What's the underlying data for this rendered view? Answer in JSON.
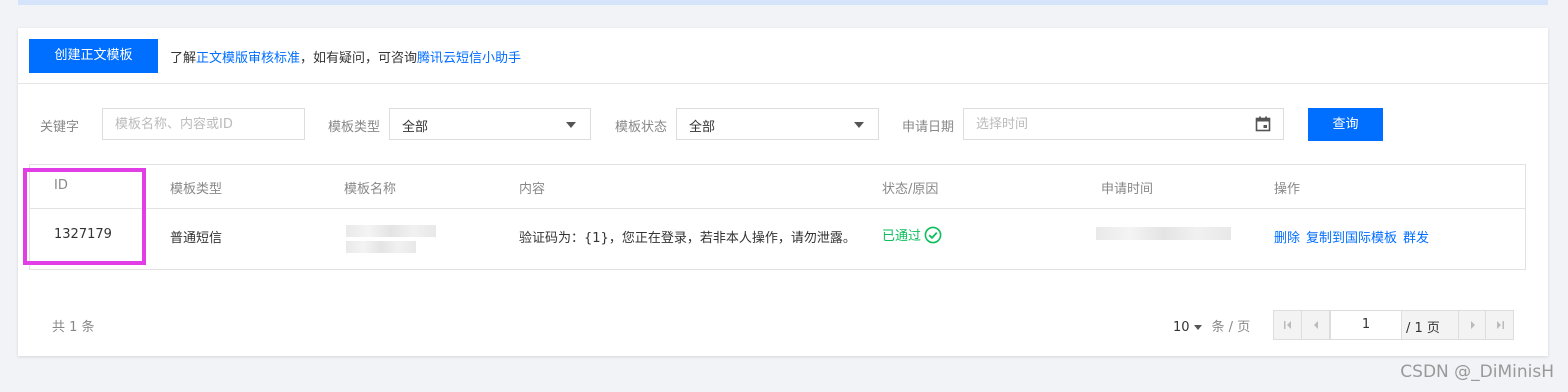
{
  "toolbar": {
    "create_button": "创建正文模板",
    "tip_prefix": "了解",
    "tip_link1": "正文模版审核标准",
    "tip_middle": "，如有疑问，可咨询",
    "tip_link2": "腾讯云短信小助手"
  },
  "filters": {
    "keyword_label": "关键字",
    "keyword_placeholder": "模板名称、内容或ID",
    "type_label": "模板类型",
    "type_value": "全部",
    "status_label": "模板状态",
    "status_value": "全部",
    "date_label": "申请日期",
    "date_placeholder": "选择时间",
    "query_button": "查询"
  },
  "table": {
    "headers": [
      "ID",
      "模板类型",
      "模板名称",
      "内容",
      "状态/原因",
      "申请时间",
      "操作"
    ],
    "rows": [
      {
        "id": "1327179",
        "type": "普通短信",
        "content": "验证码为：{1}，您正在登录，若非本人操作，请勿泄露。",
        "status": "已通过",
        "actions": [
          "删除",
          "复制到国际模板",
          "群发"
        ]
      }
    ]
  },
  "pagination": {
    "total": "共 1 条",
    "page_size": "10",
    "page_size_unit": "条 / 页",
    "current_page": "1",
    "total_pages": "/ 1 页"
  },
  "watermark": "CSDN @_DiMinisH",
  "colors": {
    "primary": "#006eff",
    "success": "#0abf5b",
    "highlight": "#e23ee6"
  }
}
